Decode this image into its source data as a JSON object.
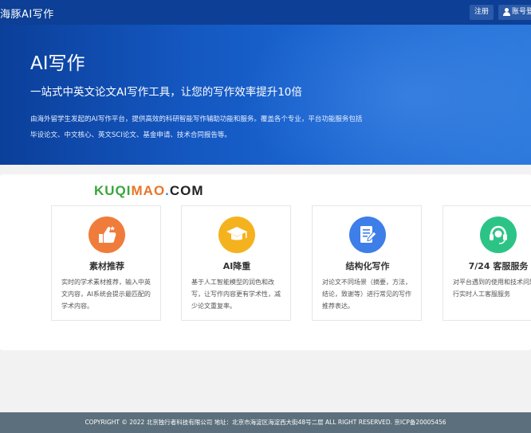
{
  "nav": {
    "brand": "海豚AI写作",
    "register_label": "注册",
    "login_label": "账号登"
  },
  "hero": {
    "title": "AI写作",
    "subtitle": "一站式中英文论文AI写作工具，让您的写作效率提升10倍",
    "desc_line1": "由海外留学生发起的AI写作平台，提供高效的科研智能写作辅助功能和服务。覆盖各个专业，平台功能服务包括",
    "desc_line2": "毕设论文、中文核心、英文SCI论文、基金申请、技术合同报告等。"
  },
  "watermark": {
    "part1": "KUQI",
    "part2": "MAO",
    "part3": ".",
    "part4": "COM"
  },
  "features": [
    {
      "title": "素材推荐",
      "icon": "thumbs-up-icon",
      "color": "#f07c3c",
      "desc": "实时的学术素材推荐，输入中英文内容，AI系统会提示最匹配的学术内容。"
    },
    {
      "title": "AI降重",
      "icon": "graduation-cap-icon",
      "color": "#f5b21f",
      "desc": "基于人工智能模型的润色和改写，让写作内容更有学术性，减少论文重复率。"
    },
    {
      "title": "结构化写作",
      "icon": "document-edit-icon",
      "color": "#3d7ee8",
      "desc": "对论文不同场景（摘要，方法，结论，致谢等）进行常见的写作推荐表达。"
    },
    {
      "title": "7/24 客服服务",
      "icon": "headset-icon",
      "color": "#2cc486",
      "desc": "对平台遇到的使用和技术问题进行实时人工客服服务"
    }
  ],
  "footer": {
    "text": "COPYRIGHT © 2022 北京独行者科技有限公司 地址：北京市海淀区海淀西大街48号二层 ALL RIGHT RESERVED. 京ICP备20005456"
  }
}
